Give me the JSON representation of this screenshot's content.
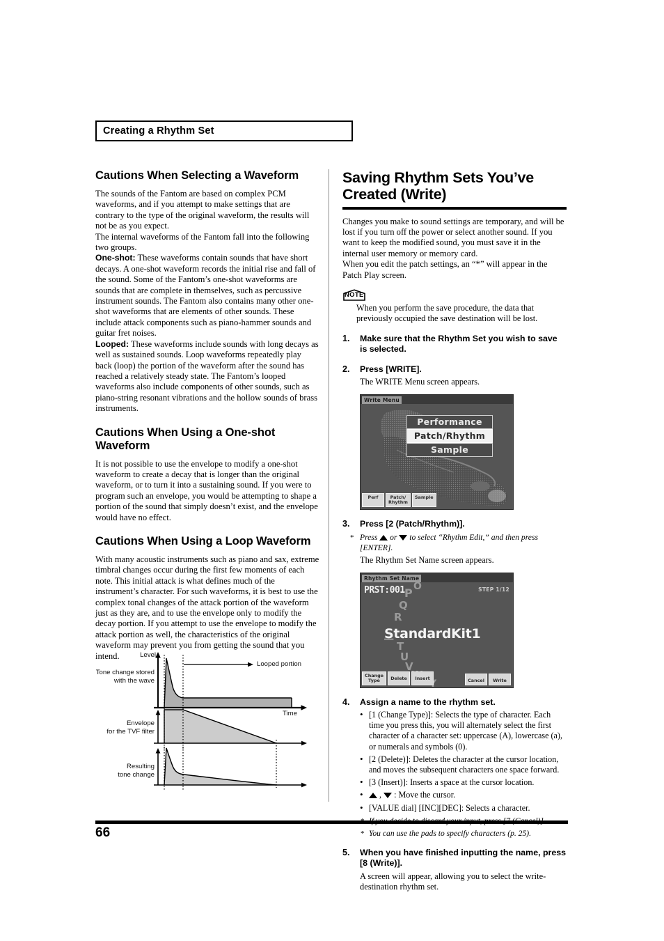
{
  "running_head": "Creating a Rhythm Set",
  "page_number": "66",
  "left_column": {
    "heading_1": "Cautions When Selecting a Waveform",
    "paragraphs_1": [
      "The sounds of the Fantom are based on complex PCM waveforms, and if you attempt to make settings that are contrary to the type of the original waveform, the results will not be as you expect.",
      "The internal waveforms of the Fantom fall into the following two groups."
    ],
    "one_shot_label": "One-shot:",
    "one_shot_text": " These waveforms contain sounds that have short decays. A one-shot waveform records the initial rise and fall of the sound. Some of the Fantom’s one-shot waveforms are sounds that are complete in themselves, such as percussive instrument sounds. The Fantom also contains many other one-shot waveforms that are elements of other sounds. These include attack components such as piano-hammer sounds and guitar fret noises.",
    "looped_label": "Looped:",
    "looped_text": " These waveforms include sounds with long decays as well as sustained sounds. Loop waveforms repeatedly play back (loop) the portion of the waveform after the sound has reached a relatively steady state. The Fantom’s looped waveforms also include components of other sounds, such as piano-string resonant vibrations and the hollow sounds of brass instruments.",
    "heading_2": "Cautions When Using a One-shot Waveform",
    "paragraph_2": "It is not possible to use the envelope to modify a one-shot waveform to create a decay that is longer than the original waveform, or to turn it into a sustaining sound. If you were to program such an envelope, you would be attempting to shape a portion of the sound that simply doesn’t exist, and the envelope would have no effect.",
    "heading_3": "Cautions When Using a Loop Waveform",
    "paragraph_3": "With many acoustic instruments such as piano and sax, extreme timbral changes occur during the first few moments of each note. This initial attack is what defines much of the instrument’s character. For such waveforms, it is best to use the complex tonal changes of the attack portion of the waveform just as they are, and to use the envelope only to modify the decay portion. If you attempt to use the envelope to modify the attack portion as well, the characteristics of the original waveform may prevent you from getting the sound that you intend."
  },
  "diagram": {
    "axis_level": "Level",
    "axis_time": "Time",
    "annotation_looped": "Looped portion",
    "label_1_line1": "Tone change stored",
    "label_1_line2": "with the wave",
    "label_2_line1": "Envelope",
    "label_2_line2": "for the TVF filter",
    "label_3_line1": "Resulting",
    "label_3_line2": "tone change"
  },
  "right_column": {
    "heading_line1": "Saving Rhythm Sets You’ve",
    "heading_line2": "Created (Write)",
    "paragraphs": [
      "Changes you make to sound settings are temporary, and will be lost if you turn off the power or select another sound. If you want to keep the modified sound, you must save it in the internal user memory or memory card.",
      "When you edit the patch settings, an “*” will appear in the Patch Play screen."
    ],
    "note_icon_label": "NOTE",
    "note_text": "When you perform the save procedure, the data that previously occupied the save destination will be lost.",
    "steps": [
      {
        "num": "1.",
        "head": "Make sure that the Rhythm Set you wish to save is selected."
      },
      {
        "num": "2.",
        "head": "Press [WRITE].",
        "sub": "The WRITE Menu screen appears."
      },
      {
        "num": "3.",
        "head": "Press [2 (Patch/Rhythm)].",
        "aster": "Press ▲ or ▼ to select “Rhythm Edit,” and then press [ENTER].",
        "aster_pre": "Press ",
        "aster_mid": " or ",
        "aster_post": " to select “Rhythm Edit,” and then press [ENTER].",
        "sub": "The Rhythm Set Name screen appears."
      },
      {
        "num": "4.",
        "head": "Assign a name to the rhythm set.",
        "bullets": [
          "[1 (Change Type)]: Selects the type of character. Each time you press this, you will alternately select the first character of a character set: uppercase (A), lowercase (a), or numerals and symbols (0).",
          "[2 (Delete)]: Deletes the character at the cursor location, and moves the subsequent characters one space forward.",
          "[3 (Insert)]: Inserts a space at the cursor location.",
          ": Move the cursor.",
          "[VALUE dial] [INC][DEC]: Selects a character."
        ],
        "cursor_bullet_suffix": " : Move the cursor.",
        "asterisks": [
          "If you decide to discard your input, press [7 (Cancel)].",
          "You can use the pads to specify characters (p. 25)."
        ]
      },
      {
        "num": "5.",
        "head": "When you have finished inputting the name, press [8 (Write)].",
        "sub": "A screen will appear, allowing you to select the write-destination rhythm set."
      }
    ],
    "lcd_write_menu": {
      "title": "Write Menu",
      "items": [
        "Performance",
        "Patch/Rhythm",
        "Sample"
      ],
      "selected": "Patch/Rhythm",
      "fkeys": [
        "Perf",
        "Patch/\nRhythm",
        "Sample"
      ],
      "fkey_1": "Perf",
      "fkey_2_line1": "Patch/",
      "fkey_2_line2": "Rhythm",
      "fkey_3": "Sample"
    },
    "lcd_rhythm_name": {
      "title": "Rhythm Set Name",
      "preset": "PRST:001",
      "step": "STEP 1/12",
      "name_first_char": "S",
      "name_rest": "tandardKit1",
      "carousel": [
        "O",
        "P",
        "Q",
        "R",
        "T",
        "U",
        "V",
        "W",
        "X",
        "Y"
      ],
      "fkey_1_line1": "Change",
      "fkey_1_line2": "Type",
      "fkey_2": "Delete",
      "fkey_3": "Insert",
      "fkey_cancel": "Cancel",
      "fkey_write": "Write"
    }
  }
}
